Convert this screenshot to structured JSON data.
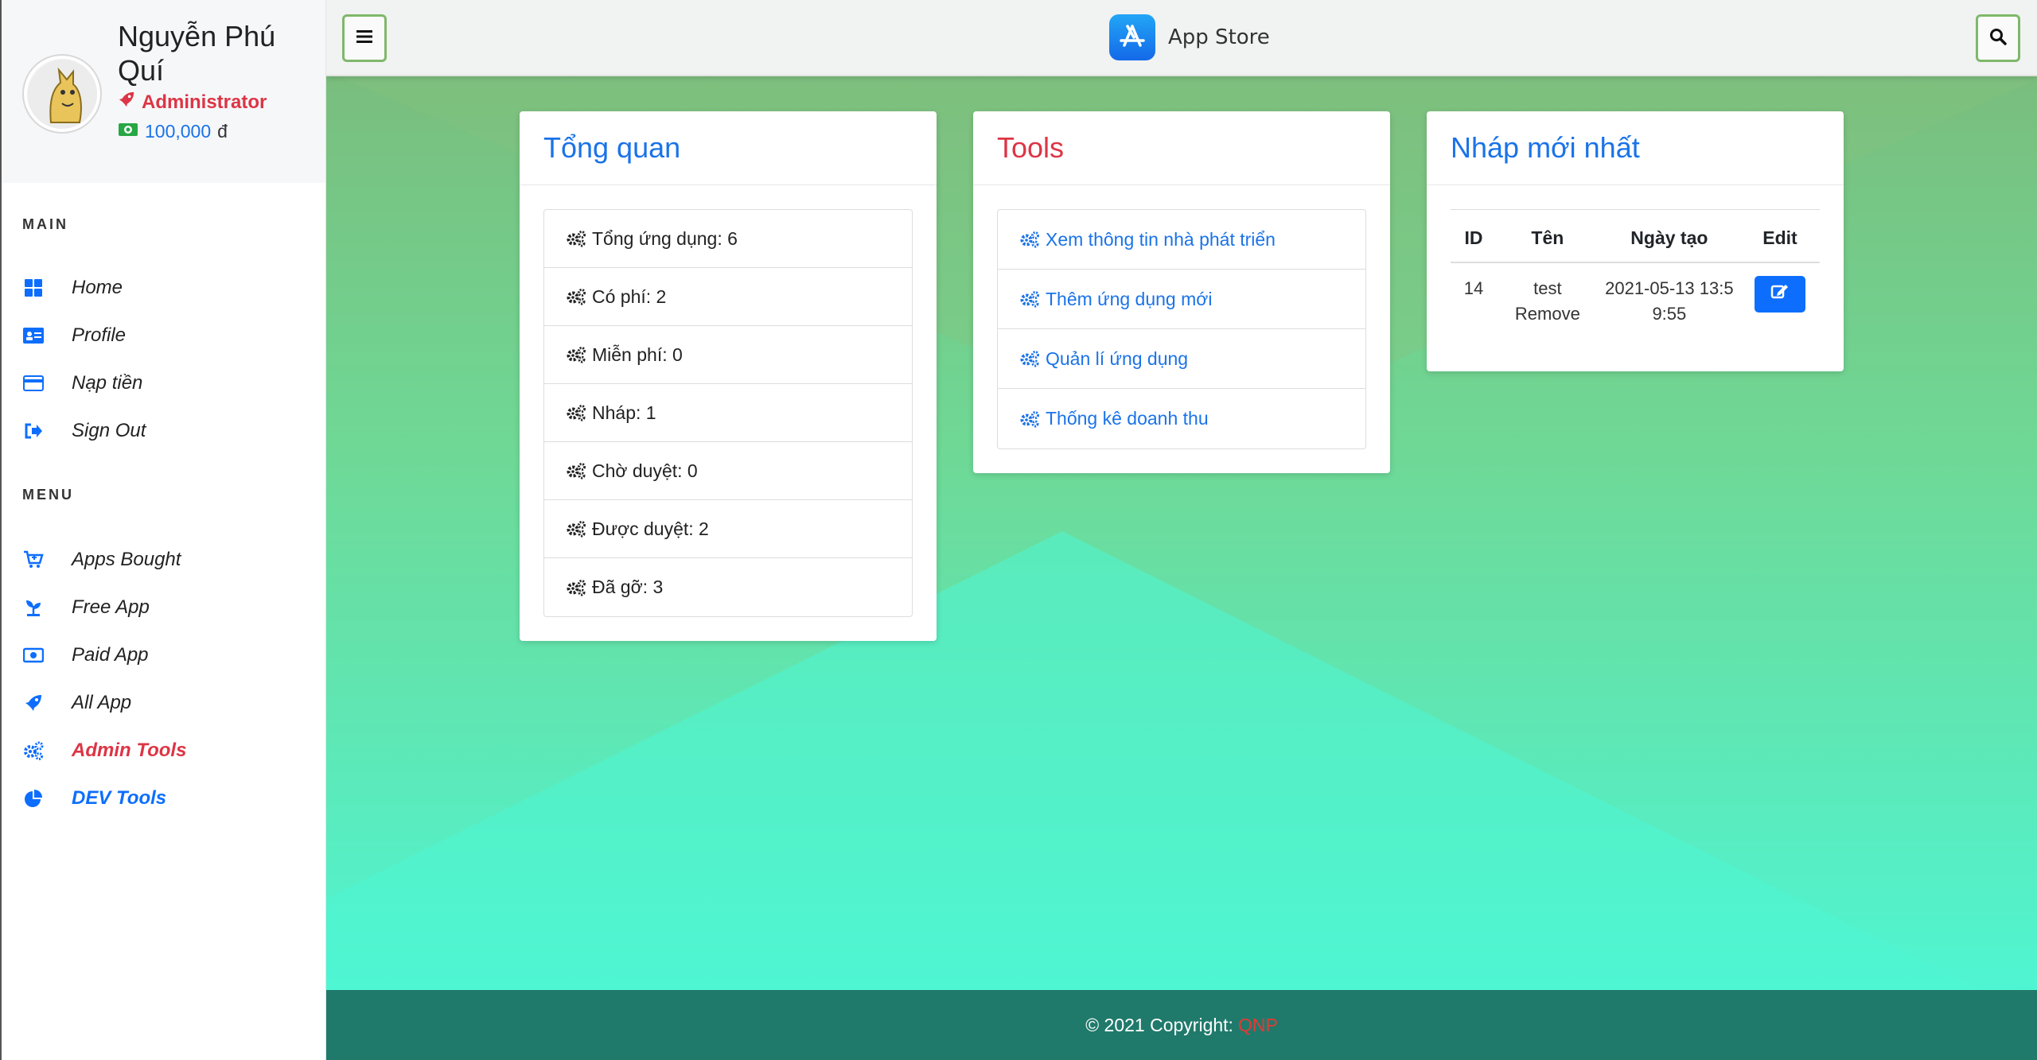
{
  "profile": {
    "name": "Nguyễn Phú Quí",
    "role": "Administrator",
    "balance": "100,000",
    "currency": "đ"
  },
  "sidebar": {
    "main_title": "MAIN",
    "main_items": [
      {
        "label": "Home",
        "icon": "grid-icon"
      },
      {
        "label": "Profile",
        "icon": "id-card-icon"
      },
      {
        "label": "Nạp tiền",
        "icon": "credit-card-icon"
      },
      {
        "label": "Sign Out",
        "icon": "sign-out-icon"
      }
    ],
    "menu_title": "MENU",
    "menu_items": [
      {
        "label": "Apps Bought",
        "icon": "cart-icon"
      },
      {
        "label": "Free App",
        "icon": "seedling-icon"
      },
      {
        "label": "Paid App",
        "icon": "money-bill-icon"
      },
      {
        "label": "All App",
        "icon": "rocket-icon"
      },
      {
        "label": "Admin Tools",
        "icon": "cogs-icon",
        "color": "#dc3545"
      },
      {
        "label": "DEV Tools",
        "icon": "pie-chart-icon",
        "color": "#0d6efd"
      }
    ]
  },
  "topbar": {
    "brand": "App Store"
  },
  "overview": {
    "title": "Tổng quan",
    "items": [
      "Tổng ứng dụng: 6",
      "Có phí: 2",
      "Miễn phí: 0",
      "Nháp: 1",
      "Chờ duyệt: 0",
      "Được duyệt: 2",
      "Đã gỡ: 3"
    ]
  },
  "tools": {
    "title": "Tools",
    "items": [
      "Xem thông tin nhà phát triển",
      "Thêm ứng dụng mới",
      "Quản lí ứng dụng",
      "Thống kê doanh thu"
    ]
  },
  "drafts": {
    "title": "Nháp mới nhất",
    "columns": [
      "ID",
      "Tên",
      "Ngày tạo",
      "Edit"
    ],
    "rows": [
      {
        "id": "14",
        "name": "test Remove",
        "created": "2021-05-13 13:59:55"
      }
    ]
  },
  "footer": {
    "copyright": "© 2021 Copyright:",
    "brand": "QNP"
  },
  "colors": {
    "accent_blue": "#0d6efd",
    "accent_red": "#dc3545",
    "footer_bg": "#207a6b"
  }
}
